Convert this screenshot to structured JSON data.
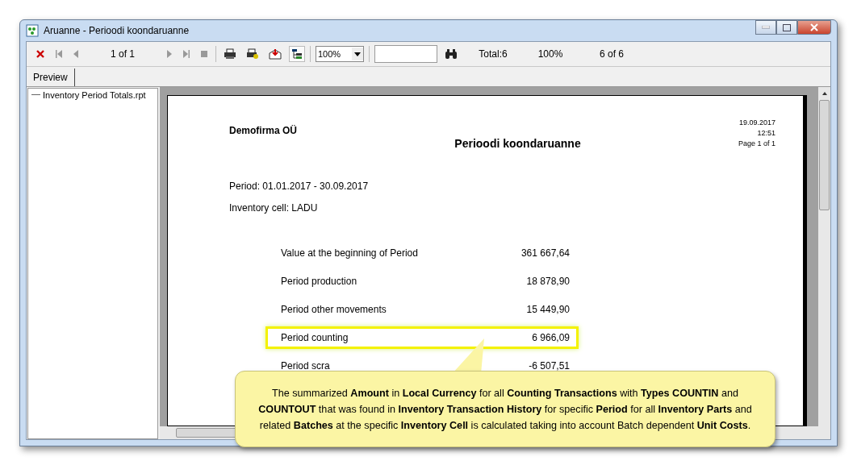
{
  "window": {
    "title": "Aruanne - Perioodi koondaruanne"
  },
  "toolbar": {
    "page": "1 of 1",
    "zoom": "100%",
    "total": "Total:6",
    "percent": "100%",
    "records": "6 of 6"
  },
  "tabs": [
    {
      "label": "Preview",
      "selected": true
    }
  ],
  "tree": {
    "items": [
      {
        "label": "Inventory Period Totals.rpt"
      }
    ]
  },
  "report": {
    "company": "Demofirma OÜ",
    "title": "Perioodi koondaruanne",
    "date": "19.09.2017",
    "time": "12:51",
    "page": "Page 1 of 1",
    "period": "Period: 01.01.2017 - 30.09.2017",
    "cell": "Inventory cell: LADU",
    "rows": [
      {
        "label": "Value at the beginning of Period",
        "value": "361 667,64",
        "highlighted": false
      },
      {
        "label": "Period production",
        "value": "18 878,90",
        "highlighted": false
      },
      {
        "label": "Period other movements",
        "value": "15 449,90",
        "highlighted": false
      },
      {
        "label": "Period counting",
        "value": "6 966,09",
        "highlighted": true
      },
      {
        "label": "Period scra",
        "value": "-6 507,51",
        "highlighted": false
      }
    ]
  },
  "callout": {
    "text": "The summarized **Amount** in **Local Currency** for all **Counting Transactions** with **Types COUNTIN** and **COUNTOUT** that was found in **Inventory Transaction History** for specific **Period** for all **Inventory Parts** and related **Batches** at the specific **Inventory Cell** is calculated taking into account Batch dependent **Unit Costs**."
  }
}
